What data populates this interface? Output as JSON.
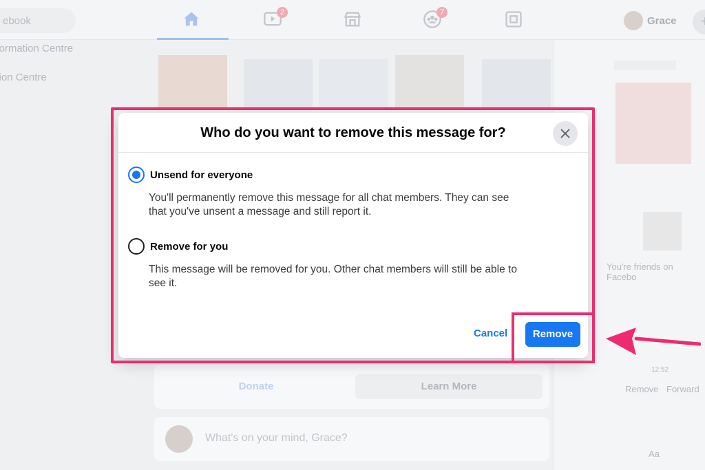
{
  "background": {
    "search_text": "ebook",
    "sidebar": [
      "nformation Centre",
      "ation Centre"
    ],
    "nav_badges": {
      "watch": "2",
      "groups": "7"
    },
    "profile_name": "Grace",
    "plus": "+",
    "buttons": {
      "donate": "Donate",
      "learn_more": "Learn More"
    },
    "composer_placeholder": "What's on your mind, Grace?",
    "chat": {
      "friends_text": "You're friends on Facebo",
      "time": "12:52",
      "remove": "Remove",
      "forward": "Forward",
      "input_placeholder": "Aa"
    }
  },
  "modal": {
    "title": "Who do you want to remove this message for?",
    "options": [
      {
        "label": "Unsend for everyone",
        "desc_line1": "You'll permanently remove this message for all chat members. They can see",
        "desc_line2": "that you've unsent a message and still report it.",
        "selected": true
      },
      {
        "label": "Remove for you",
        "desc_line1": "This message will be removed for you. Other chat members will still be able to",
        "desc_line2": "see it.",
        "selected": false
      }
    ],
    "cancel_label": "Cancel",
    "remove_label": "Remove"
  },
  "colors": {
    "accent": "#1877f2",
    "highlight": "#ee2c6d"
  },
  "icons": [
    "home-icon",
    "watch-icon",
    "marketplace-icon",
    "groups-icon",
    "gaming-icon",
    "close-icon",
    "arrow-icon"
  ]
}
